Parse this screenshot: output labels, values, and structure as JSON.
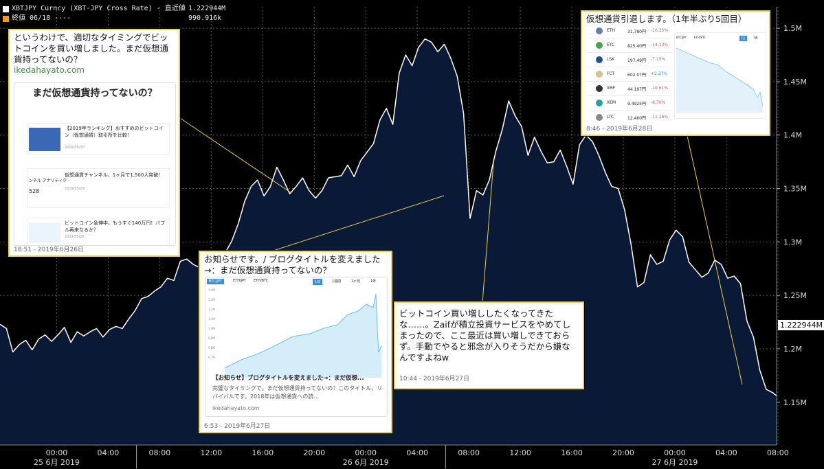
{
  "legend": {
    "row1_label": "XBTJPY Curncy (XBT-JPY Cross Rate) - 直近値",
    "row1_value": "1.222944M",
    "row2_label": "終値 06/18 ----",
    "row2_value": "990.916k",
    "series_color": "#ffffff",
    "ref_color": "#f39c12"
  },
  "price_tag": "1.222944M",
  "chart_data": {
    "type": "area",
    "ylim": [
      1.11,
      1.52
    ],
    "yticks": [
      1.15,
      1.2,
      1.25,
      1.3,
      1.35,
      1.4,
      1.45,
      1.5
    ],
    "ytick_labels": [
      "1.15M",
      "1.2M",
      "1.25M",
      "1.3M",
      "1.35M",
      "1.4M",
      "1.45M",
      "1.5M"
    ],
    "xlim": [
      -3.4,
      56.9
    ],
    "xticks": [
      1,
      5,
      9,
      13,
      17,
      21,
      25,
      29,
      33,
      37,
      41,
      45,
      49,
      53,
      57
    ],
    "xtick_labels": [
      "00:00",
      "04:00",
      "08:00",
      "12:00",
      "16:00",
      "20:00",
      "00:00",
      "04:00",
      "08:00",
      "12:00",
      "16:00",
      "20:00",
      "00:00",
      "04:00",
      "08:00"
    ],
    "date_labels": [
      {
        "text": "25 6月 2019",
        "x": 1
      },
      {
        "text": "26 6月 2019",
        "x": 25
      },
      {
        "text": "27 6月 2019",
        "x": 49
      }
    ],
    "day_separators": [
      7.2,
      31.2
    ],
    "series": [
      {
        "color": "#ffffff",
        "fill": "#0a1a36",
        "points": [
          [
            -3.4,
            1.223
          ],
          [
            -2.9,
            1.219
          ],
          [
            -2.4,
            1.197
          ],
          [
            -1.9,
            1.204
          ],
          [
            -1.4,
            1.208
          ],
          [
            -0.9,
            1.199
          ],
          [
            -0.4,
            1.209
          ],
          [
            0.1,
            1.213
          ],
          [
            0.6,
            1.207
          ],
          [
            1.1,
            1.213
          ],
          [
            1.6,
            1.22
          ],
          [
            2.1,
            1.206
          ],
          [
            2.6,
            1.216
          ],
          [
            3.1,
            1.212
          ],
          [
            3.6,
            1.216
          ],
          [
            4.1,
            1.219
          ],
          [
            4.6,
            1.211
          ],
          [
            5.1,
            1.218
          ],
          [
            5.6,
            1.221
          ],
          [
            6.1,
            1.219
          ],
          [
            6.6,
            1.228
          ],
          [
            7.1,
            1.236
          ],
          [
            7.6,
            1.247
          ],
          [
            8.1,
            1.249
          ],
          [
            8.6,
            1.254
          ],
          [
            9.1,
            1.258
          ],
          [
            9.6,
            1.266
          ],
          [
            10.1,
            1.264
          ],
          [
            10.6,
            1.282
          ],
          [
            11.1,
            1.284
          ],
          [
            11.6,
            1.279
          ],
          [
            12.1,
            1.276
          ],
          [
            12.6,
            1.287
          ],
          [
            13.1,
            1.272
          ],
          [
            13.6,
            1.282
          ],
          [
            14.1,
            1.29
          ],
          [
            14.6,
            1.301
          ],
          [
            15.1,
            1.317
          ],
          [
            15.6,
            1.338
          ],
          [
            16.1,
            1.352
          ],
          [
            16.6,
            1.358
          ],
          [
            17.1,
            1.343
          ],
          [
            17.6,
            1.352
          ],
          [
            18.1,
            1.37
          ],
          [
            18.6,
            1.358
          ],
          [
            19.1,
            1.345
          ],
          [
            19.6,
            1.352
          ],
          [
            20.1,
            1.36
          ],
          [
            20.6,
            1.348
          ],
          [
            21.1,
            1.341
          ],
          [
            21.6,
            1.348
          ],
          [
            22.1,
            1.36
          ],
          [
            22.6,
            1.361
          ],
          [
            23.1,
            1.362
          ],
          [
            23.6,
            1.372
          ],
          [
            24.1,
            1.361
          ],
          [
            24.6,
            1.376
          ],
          [
            25.1,
            1.384
          ],
          [
            25.6,
            1.392
          ],
          [
            26.1,
            1.414
          ],
          [
            26.6,
            1.425
          ],
          [
            27.1,
            1.41
          ],
          [
            27.6,
            1.458
          ],
          [
            28.1,
            1.475
          ],
          [
            28.6,
            1.465
          ],
          [
            29.1,
            1.482
          ],
          [
            29.6,
            1.49
          ],
          [
            30.1,
            1.487
          ],
          [
            30.6,
            1.478
          ],
          [
            31.1,
            1.485
          ],
          [
            31.6,
            1.472
          ],
          [
            32.1,
            1.455
          ],
          [
            32.6,
            1.42
          ],
          [
            33.1,
            1.322
          ],
          [
            33.6,
            1.348
          ],
          [
            34.1,
            1.344
          ],
          [
            34.6,
            1.358
          ],
          [
            35.1,
            1.385
          ],
          [
            35.6,
            1.405
          ],
          [
            36.1,
            1.432
          ],
          [
            36.6,
            1.418
          ],
          [
            37.1,
            1.408
          ],
          [
            37.6,
            1.381
          ],
          [
            38.1,
            1.398
          ],
          [
            38.6,
            1.385
          ],
          [
            39.1,
            1.374
          ],
          [
            39.6,
            1.375
          ],
          [
            40.1,
            1.386
          ],
          [
            40.6,
            1.371
          ],
          [
            41.1,
            1.354
          ],
          [
            41.6,
            1.391
          ],
          [
            42.1,
            1.4
          ],
          [
            42.6,
            1.394
          ],
          [
            43.1,
            1.381
          ],
          [
            43.6,
            1.365
          ],
          [
            44.1,
            1.352
          ],
          [
            44.6,
            1.35
          ],
          [
            45.1,
            1.33
          ],
          [
            45.6,
            1.298
          ],
          [
            46.1,
            1.258
          ],
          [
            46.6,
            1.262
          ],
          [
            47.1,
            1.288
          ],
          [
            47.6,
            1.279
          ],
          [
            48.1,
            1.282
          ],
          [
            48.6,
            1.302
          ],
          [
            49.1,
            1.311
          ],
          [
            49.6,
            1.305
          ],
          [
            50.1,
            1.281
          ],
          [
            50.6,
            1.274
          ],
          [
            51.1,
            1.267
          ],
          [
            51.6,
            1.271
          ],
          [
            52.1,
            1.283
          ],
          [
            52.6,
            1.279
          ],
          [
            53.1,
            1.266
          ],
          [
            53.6,
            1.268
          ],
          [
            54.1,
            1.261
          ],
          [
            54.6,
            1.226
          ],
          [
            55.1,
            1.211
          ],
          [
            55.6,
            1.18
          ],
          [
            56.1,
            1.162
          ],
          [
            56.6,
            1.159
          ],
          [
            56.9,
            1.156
          ]
        ]
      }
    ]
  },
  "annotations": [
    {
      "text": "というわけで、適切なタイミングでビットコインを買い増しました。まだ仮想通貨持ってないの？",
      "link": "ikedahayato.com",
      "thumb_title": "まだ仮想通貨持ってないの？",
      "items": [
        {
          "title": "【2019年ランキング】おすすめのビットコイン（仮想通貨）取引所を比較！",
          "date": "2019/05/30"
        },
        {
          "title": "仮想通貨チャンネル、1ヶ月で1,500人突破！",
          "date": "2019/05/29"
        },
        {
          "title": "ビットコイン急伸中。もうすぐ140万円！バブル再来なるか？",
          "date": "2019/05/28"
        }
      ],
      "stat_number": "528",
      "stat_label": "ンネル アナリティク",
      "timestamp": "18:51 - 2019年6月26日"
    },
    {
      "text": "お知らせです。/ ブログタイトルを変えました→：まだ仮想通貨持ってないの？",
      "thumb_tabs": [
        "BTC/JPY",
        "ETH/JPY",
        "ETH/BTC"
      ],
      "thumb_tabs_right": [
        "1日",
        "1週間",
        "1ヶ月",
        "1年"
      ],
      "thumb_yaxis": [
        "1.4M",
        "1.3M",
        "1.2M",
        "1.1M",
        "1.0M",
        "0.9M",
        "0.8M",
        "0.7M"
      ],
      "card_title": "【お知らせ】ブログタイトルを変えました→：まだ仮想...",
      "card_desc": "完璧なタイミングで。まだ仮想通貨持ってないの？このタイトル、リバイバルです。2018年は仮想通貨への読...",
      "card_link": "ikedahayato.com",
      "timestamp": "6:53 - 2019年6月27日"
    },
    {
      "text": "ビットコイン買い増ししたくなってきたな……。Zaifが積立投資サービスをやめてしまったので、ここ最近は買い増しできておらず。手動でやると邪念が入りそうだから嫌なんですよねw",
      "timestamp": "10:44 - 2019年6月27日"
    },
    {
      "text": "仮想通貨引退します。（1年半ぶり5回目）",
      "coins": [
        {
          "sym": "ETH",
          "price": "31,780円",
          "chg": "-10.35%"
        },
        {
          "sym": "ETC",
          "price": "825.40円",
          "chg": "-14.13%"
        },
        {
          "sym": "LSK",
          "price": "197.49円",
          "chg": "-7.15%"
        },
        {
          "sym": "FCT",
          "price": "602.07円",
          "chg": "+2.37%"
        },
        {
          "sym": "XRP",
          "price": "44.197円",
          "chg": "-10.61%"
        },
        {
          "sym": "XEM",
          "price": "9.4925円",
          "chg": "-8.70%"
        },
        {
          "sym": "LTC",
          "price": "12,460円",
          "chg": "-11.16%"
        }
      ],
      "mini_tabs": [
        "BTC/JPY",
        "ETH/BTC"
      ],
      "mini_range": [
        "1日",
        "1週"
      ],
      "timestamp": "8:46 - 2019年6月28日"
    }
  ]
}
